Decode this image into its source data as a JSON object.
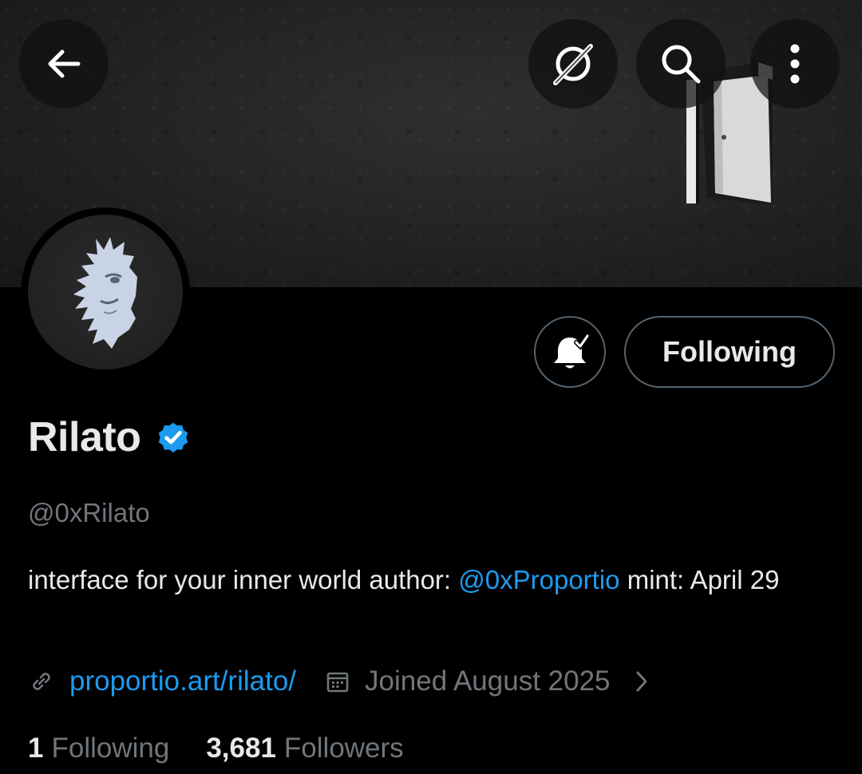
{
  "header": {
    "back_icon": "arrow-left-icon",
    "grok_icon": "grok-icon",
    "search_icon": "search-icon",
    "more_icon": "more-vertical-icon"
  },
  "profile": {
    "name": "Rilato",
    "verified_icon": "verified-badge-icon",
    "verified_color": "#1d9bf0",
    "handle": "@0xRilato",
    "bio": {
      "text_before": "interface for your inner world author: ",
      "mention": "@0xProportio",
      "text_after": " mint: April 29"
    },
    "link": "proportio.art/rilato/",
    "joined": "Joined August 2025"
  },
  "actions": {
    "notifications_icon": "bell-check-icon",
    "following_label": "Following"
  },
  "stats": {
    "following_count": "1",
    "following_label": "Following",
    "followers_count": "3,681",
    "followers_label": "Followers"
  },
  "colors": {
    "background": "#000000",
    "accent": "#1d9bf0",
    "secondary_text": "#71767b",
    "primary_text": "#e7e9ea",
    "border": "#536471"
  }
}
